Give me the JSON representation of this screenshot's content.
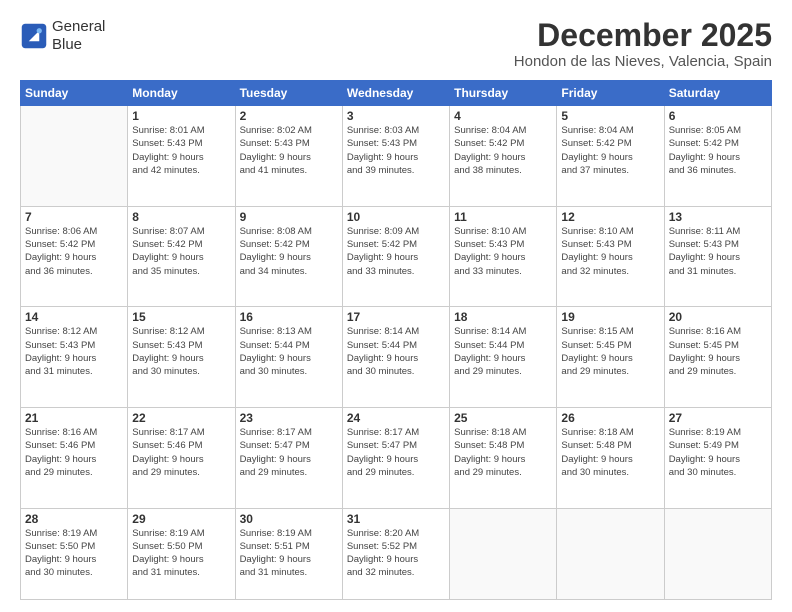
{
  "header": {
    "logo_line1": "General",
    "logo_line2": "Blue",
    "month": "December 2025",
    "location": "Hondon de las Nieves, Valencia, Spain"
  },
  "days_of_week": [
    "Sunday",
    "Monday",
    "Tuesday",
    "Wednesday",
    "Thursday",
    "Friday",
    "Saturday"
  ],
  "weeks": [
    [
      {
        "day": "",
        "info": ""
      },
      {
        "day": "1",
        "info": "Sunrise: 8:01 AM\nSunset: 5:43 PM\nDaylight: 9 hours\nand 42 minutes."
      },
      {
        "day": "2",
        "info": "Sunrise: 8:02 AM\nSunset: 5:43 PM\nDaylight: 9 hours\nand 41 minutes."
      },
      {
        "day": "3",
        "info": "Sunrise: 8:03 AM\nSunset: 5:43 PM\nDaylight: 9 hours\nand 39 minutes."
      },
      {
        "day": "4",
        "info": "Sunrise: 8:04 AM\nSunset: 5:42 PM\nDaylight: 9 hours\nand 38 minutes."
      },
      {
        "day": "5",
        "info": "Sunrise: 8:04 AM\nSunset: 5:42 PM\nDaylight: 9 hours\nand 37 minutes."
      },
      {
        "day": "6",
        "info": "Sunrise: 8:05 AM\nSunset: 5:42 PM\nDaylight: 9 hours\nand 36 minutes."
      }
    ],
    [
      {
        "day": "7",
        "info": "Sunrise: 8:06 AM\nSunset: 5:42 PM\nDaylight: 9 hours\nand 36 minutes."
      },
      {
        "day": "8",
        "info": "Sunrise: 8:07 AM\nSunset: 5:42 PM\nDaylight: 9 hours\nand 35 minutes."
      },
      {
        "day": "9",
        "info": "Sunrise: 8:08 AM\nSunset: 5:42 PM\nDaylight: 9 hours\nand 34 minutes."
      },
      {
        "day": "10",
        "info": "Sunrise: 8:09 AM\nSunset: 5:42 PM\nDaylight: 9 hours\nand 33 minutes."
      },
      {
        "day": "11",
        "info": "Sunrise: 8:10 AM\nSunset: 5:43 PM\nDaylight: 9 hours\nand 33 minutes."
      },
      {
        "day": "12",
        "info": "Sunrise: 8:10 AM\nSunset: 5:43 PM\nDaylight: 9 hours\nand 32 minutes."
      },
      {
        "day": "13",
        "info": "Sunrise: 8:11 AM\nSunset: 5:43 PM\nDaylight: 9 hours\nand 31 minutes."
      }
    ],
    [
      {
        "day": "14",
        "info": "Sunrise: 8:12 AM\nSunset: 5:43 PM\nDaylight: 9 hours\nand 31 minutes."
      },
      {
        "day": "15",
        "info": "Sunrise: 8:12 AM\nSunset: 5:43 PM\nDaylight: 9 hours\nand 30 minutes."
      },
      {
        "day": "16",
        "info": "Sunrise: 8:13 AM\nSunset: 5:44 PM\nDaylight: 9 hours\nand 30 minutes."
      },
      {
        "day": "17",
        "info": "Sunrise: 8:14 AM\nSunset: 5:44 PM\nDaylight: 9 hours\nand 30 minutes."
      },
      {
        "day": "18",
        "info": "Sunrise: 8:14 AM\nSunset: 5:44 PM\nDaylight: 9 hours\nand 29 minutes."
      },
      {
        "day": "19",
        "info": "Sunrise: 8:15 AM\nSunset: 5:45 PM\nDaylight: 9 hours\nand 29 minutes."
      },
      {
        "day": "20",
        "info": "Sunrise: 8:16 AM\nSunset: 5:45 PM\nDaylight: 9 hours\nand 29 minutes."
      }
    ],
    [
      {
        "day": "21",
        "info": "Sunrise: 8:16 AM\nSunset: 5:46 PM\nDaylight: 9 hours\nand 29 minutes."
      },
      {
        "day": "22",
        "info": "Sunrise: 8:17 AM\nSunset: 5:46 PM\nDaylight: 9 hours\nand 29 minutes."
      },
      {
        "day": "23",
        "info": "Sunrise: 8:17 AM\nSunset: 5:47 PM\nDaylight: 9 hours\nand 29 minutes."
      },
      {
        "day": "24",
        "info": "Sunrise: 8:17 AM\nSunset: 5:47 PM\nDaylight: 9 hours\nand 29 minutes."
      },
      {
        "day": "25",
        "info": "Sunrise: 8:18 AM\nSunset: 5:48 PM\nDaylight: 9 hours\nand 29 minutes."
      },
      {
        "day": "26",
        "info": "Sunrise: 8:18 AM\nSunset: 5:48 PM\nDaylight: 9 hours\nand 30 minutes."
      },
      {
        "day": "27",
        "info": "Sunrise: 8:19 AM\nSunset: 5:49 PM\nDaylight: 9 hours\nand 30 minutes."
      }
    ],
    [
      {
        "day": "28",
        "info": "Sunrise: 8:19 AM\nSunset: 5:50 PM\nDaylight: 9 hours\nand 30 minutes."
      },
      {
        "day": "29",
        "info": "Sunrise: 8:19 AM\nSunset: 5:50 PM\nDaylight: 9 hours\nand 31 minutes."
      },
      {
        "day": "30",
        "info": "Sunrise: 8:19 AM\nSunset: 5:51 PM\nDaylight: 9 hours\nand 31 minutes."
      },
      {
        "day": "31",
        "info": "Sunrise: 8:20 AM\nSunset: 5:52 PM\nDaylight: 9 hours\nand 32 minutes."
      },
      {
        "day": "",
        "info": ""
      },
      {
        "day": "",
        "info": ""
      },
      {
        "day": "",
        "info": ""
      }
    ]
  ]
}
